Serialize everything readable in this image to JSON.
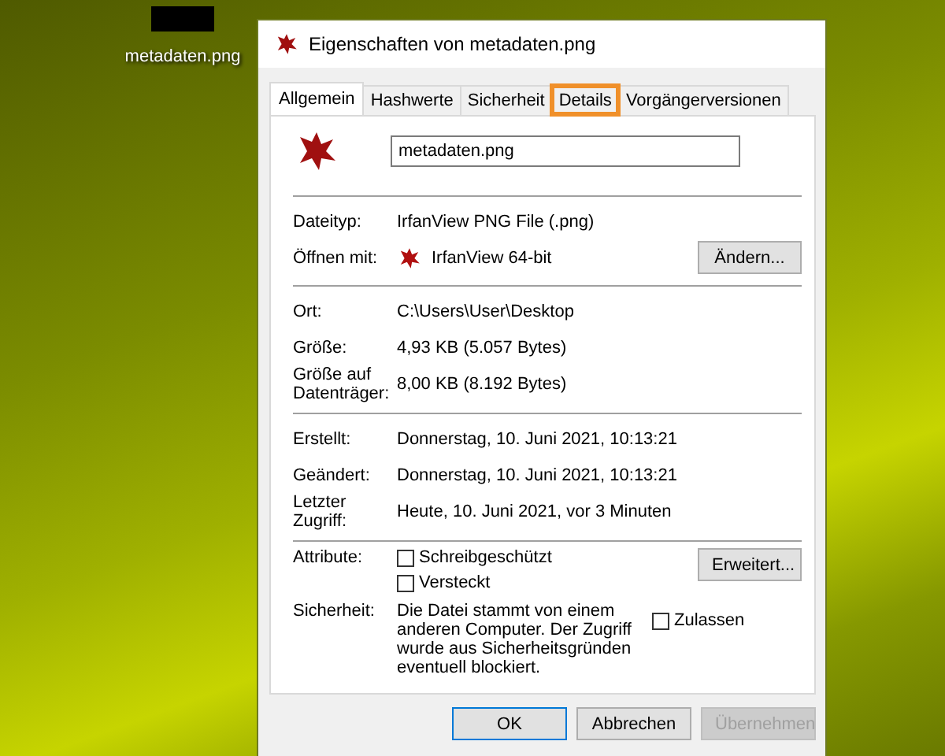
{
  "desktop_icon": {
    "label": "metadaten.png"
  },
  "window": {
    "title": "Eigenschaften von metadaten.png"
  },
  "tabs": [
    {
      "label": "Allgemein",
      "selected": true,
      "highlighted": false
    },
    {
      "label": "Hashwerte",
      "selected": false,
      "highlighted": false
    },
    {
      "label": "Sicherheit",
      "selected": false,
      "highlighted": false
    },
    {
      "label": "Details",
      "selected": false,
      "highlighted": true
    },
    {
      "label": "Vorgängerversionen",
      "selected": false,
      "highlighted": false
    }
  ],
  "filename": "metadaten.png",
  "sections": [
    [
      {
        "kind": "text",
        "label": "Dateityp:",
        "value": "IrfanView PNG File (.png)"
      },
      {
        "kind": "app",
        "label": "Öffnen mit:",
        "value": "IrfanView 64-bit",
        "button": "Ändern..."
      }
    ],
    [
      {
        "kind": "text",
        "label": "Ort:",
        "value": "C:\\Users\\User\\Desktop"
      },
      {
        "kind": "text",
        "label": "Größe:",
        "value": "4,93 KB (5.057 Bytes)"
      },
      {
        "kind": "text",
        "label": "Größe auf Datenträger:",
        "value": "8,00 KB (8.192 Bytes)"
      }
    ],
    [
      {
        "kind": "text",
        "label": "Erstellt:",
        "value": "Donnerstag, 10. Juni 2021, 10:13:21"
      },
      {
        "kind": "text",
        "label": "Geändert:",
        "value": "Donnerstag, 10. Juni 2021, 10:13:21"
      },
      {
        "kind": "text",
        "label": "Letzter Zugriff:",
        "value": "Heute, 10. Juni 2021, vor 3 Minuten"
      }
    ]
  ],
  "attributes": {
    "label": "Attribute:",
    "button": "Erweitert...",
    "checkboxes": [
      {
        "label": "Schreibgeschützt",
        "checked": false
      },
      {
        "label": "Versteckt",
        "checked": false
      }
    ]
  },
  "security": {
    "label": "Sicherheit:",
    "text": "Die Datei stammt von einem anderen Computer. Der Zugriff wurde aus Sicherheitsgründen eventuell blockiert.",
    "checkbox": {
      "label": "Zulassen",
      "checked": false
    }
  },
  "buttons": [
    {
      "label": "OK",
      "default": true,
      "disabled": false
    },
    {
      "label": "Abbrechen",
      "default": false,
      "disabled": false
    },
    {
      "label": "Übernehmen",
      "default": false,
      "disabled": true
    }
  ]
}
